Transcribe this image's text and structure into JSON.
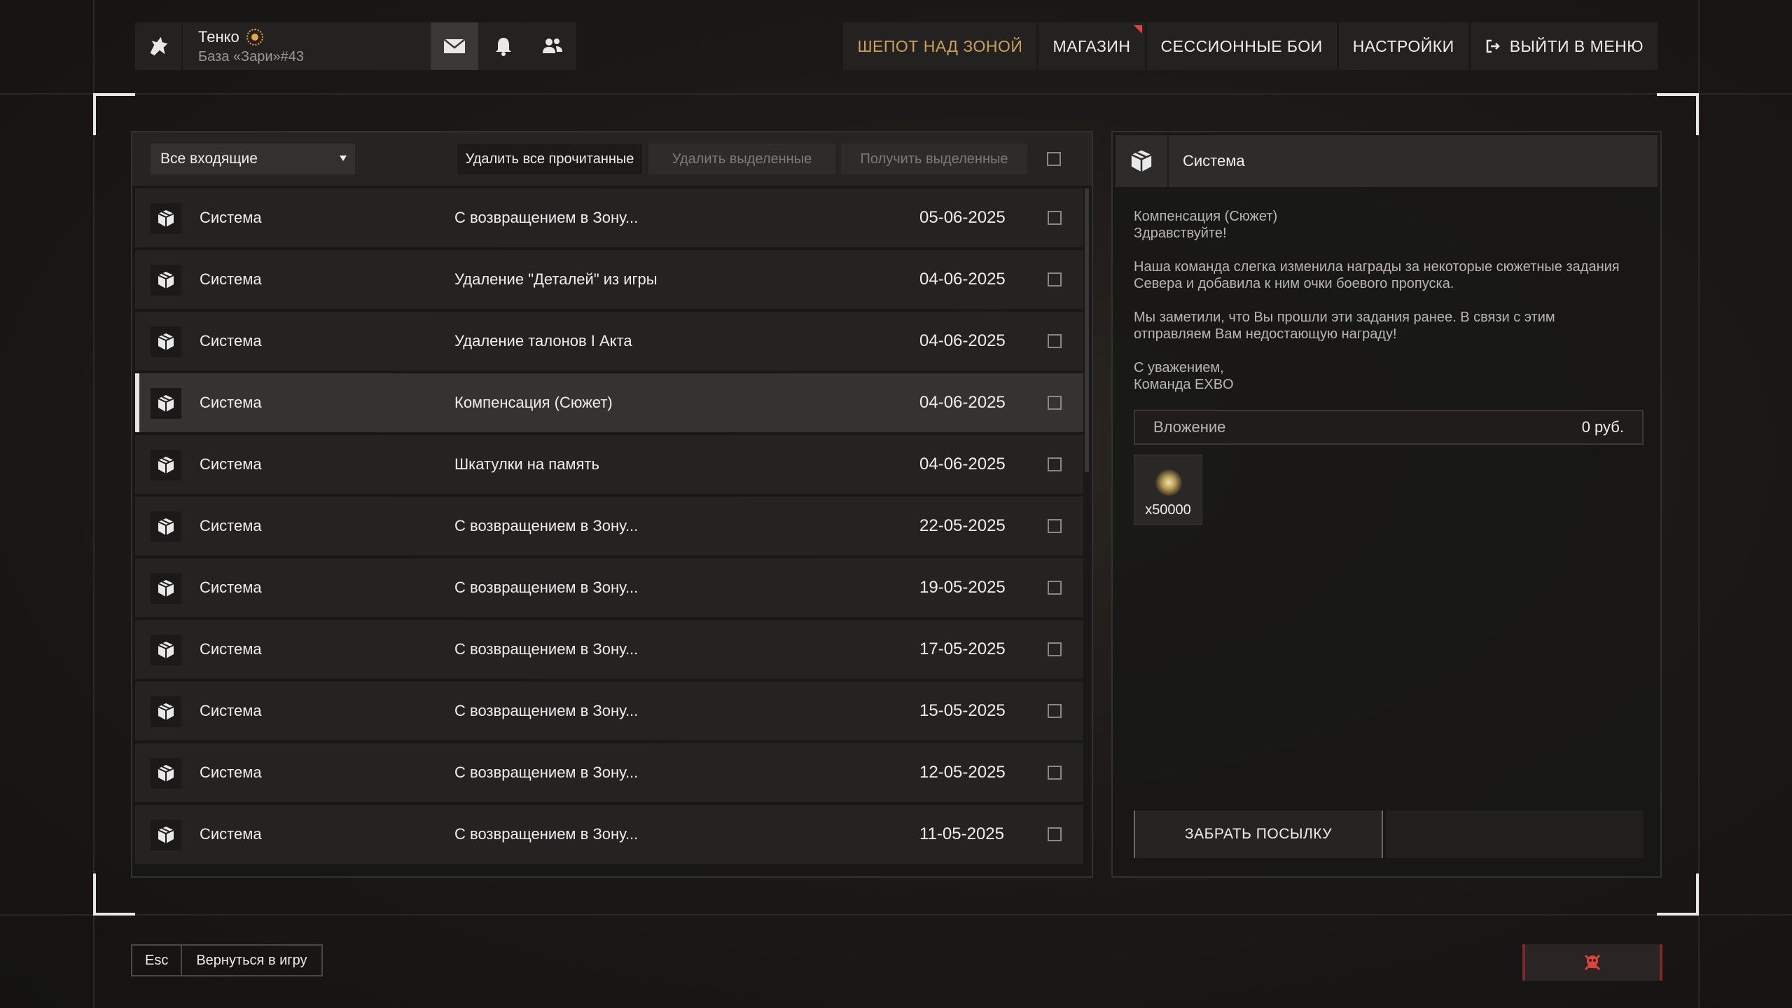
{
  "profile": {
    "name": "Тенко",
    "base": "База «Зари»#43"
  },
  "nav": {
    "items": [
      {
        "label": "ШЕПОТ НАД ЗОНОЙ"
      },
      {
        "label": "МАГАЗИН"
      },
      {
        "label": "СЕССИОННЫЕ БОИ"
      },
      {
        "label": "НАСТРОЙКИ"
      },
      {
        "label": "ВЫЙТИ В МЕНЮ"
      }
    ]
  },
  "toolbar": {
    "filter": "Все входящие",
    "delete_read": "Удалить все прочитанные",
    "delete_selected": "Удалить выделенные",
    "receive_selected": "Получить выделенные"
  },
  "messages": [
    {
      "sender": "Система",
      "subject": "С возвращением в Зону...",
      "date": "05-06-2025"
    },
    {
      "sender": "Система",
      "subject": "Удаление \"Деталей\" из игры",
      "date": "04-06-2025"
    },
    {
      "sender": "Система",
      "subject": "Удаление талонов I Акта",
      "date": "04-06-2025"
    },
    {
      "sender": "Система",
      "subject": "Компенсация (Сюжет)",
      "date": "04-06-2025"
    },
    {
      "sender": "Система",
      "subject": "Шкатулки на память",
      "date": "04-06-2025"
    },
    {
      "sender": "Система",
      "subject": "С возвращением в Зону...",
      "date": "22-05-2025"
    },
    {
      "sender": "Система",
      "subject": "С возвращением в Зону...",
      "date": "19-05-2025"
    },
    {
      "sender": "Система",
      "subject": "С возвращением в Зону...",
      "date": "17-05-2025"
    },
    {
      "sender": "Система",
      "subject": "С возвращением в Зону...",
      "date": "15-05-2025"
    },
    {
      "sender": "Система",
      "subject": "С возвращением в Зону...",
      "date": "12-05-2025"
    },
    {
      "sender": "Система",
      "subject": "С возвращением в Зону...",
      "date": "11-05-2025"
    }
  ],
  "detail": {
    "sender": "Система",
    "title": "Компенсация (Сюжет)",
    "greeting": "Здравствуйте!",
    "paragraph1": "Наша команда слегка изменила награды за некоторые сюжетные задания Севера и добавила к ним очки боевого пропуска.",
    "paragraph2": "Мы заметили, что Вы прошли эти задания ранее. В связи с этим отправляем Вам недостающую награду!",
    "sign1": "С уважением,",
    "sign2": "Команда EXBO",
    "attachment_label": "Вложение",
    "attachment_amount": "0 руб.",
    "item_qty": "x50000",
    "claim_label": "ЗАБРАТЬ ПОСЫЛКУ"
  },
  "bottom": {
    "esc_key": "Esc",
    "return_label": "Вернуться в игру"
  },
  "colors": {
    "accent_gold": "#c9a35a",
    "notify_red": "#d9443c",
    "danger": "#d9443c"
  }
}
